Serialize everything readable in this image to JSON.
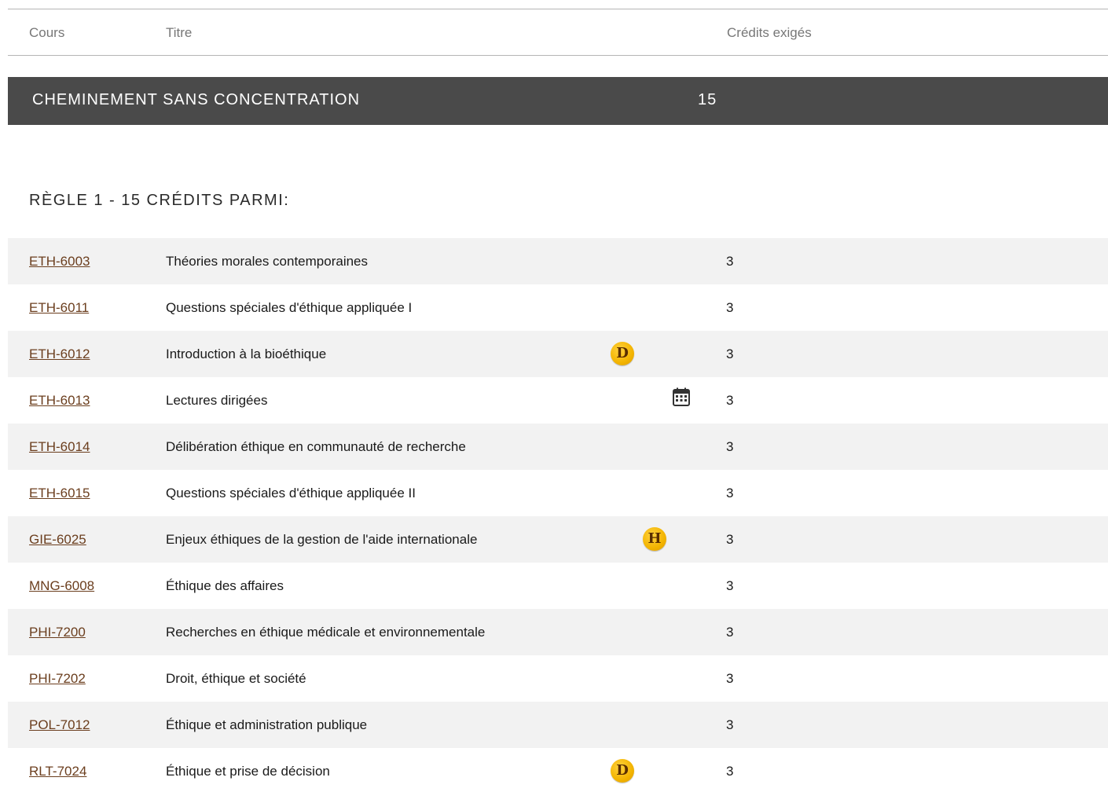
{
  "table_header": {
    "code_label": "Cours",
    "title_label": "Titre",
    "credits_label": "Crédits exigés"
  },
  "section": {
    "title": "CHEMINEMENT SANS CONCENTRATION",
    "credits": "15"
  },
  "rule": {
    "title": "RÈGLE 1 - 15 CRÉDITS PARMI:"
  },
  "courses": [
    {
      "code": "ETH-6003",
      "title": "Théories morales contemporaines",
      "credits": "3",
      "icon": ""
    },
    {
      "code": "ETH-6011",
      "title": "Questions spéciales d'éthique appliquée I",
      "credits": "3",
      "icon": ""
    },
    {
      "code": "ETH-6012",
      "title": "Introduction à la bioéthique",
      "credits": "3",
      "icon": "D"
    },
    {
      "code": "ETH-6013",
      "title": "Lectures dirigées",
      "credits": "3",
      "icon": "calendar-icon"
    },
    {
      "code": "ETH-6014",
      "title": "Délibération éthique en communauté de recherche",
      "credits": "3",
      "icon": ""
    },
    {
      "code": "ETH-6015",
      "title": "Questions spéciales d'éthique appliquée II",
      "credits": "3",
      "icon": ""
    },
    {
      "code": "GIE-6025",
      "title": "Enjeux éthiques de la gestion de l'aide internationale",
      "credits": "3",
      "icon": "H"
    },
    {
      "code": "MNG-6008",
      "title": "Éthique des affaires",
      "credits": "3",
      "icon": ""
    },
    {
      "code": "PHI-7200",
      "title": "Recherches en éthique médicale et environnementale",
      "credits": "3",
      "icon": ""
    },
    {
      "code": "PHI-7202",
      "title": "Droit, éthique et société",
      "credits": "3",
      "icon": ""
    },
    {
      "code": "POL-7012",
      "title": "Éthique et administration publique",
      "credits": "3",
      "icon": ""
    },
    {
      "code": "RLT-7024",
      "title": "Éthique et prise de décision",
      "credits": "3",
      "icon": "D"
    }
  ],
  "colors": {
    "section_bar": "#4a4a4a",
    "row_shade": "#f2f2f2",
    "link": "#6b3e1e",
    "badge": "#f3b400"
  }
}
